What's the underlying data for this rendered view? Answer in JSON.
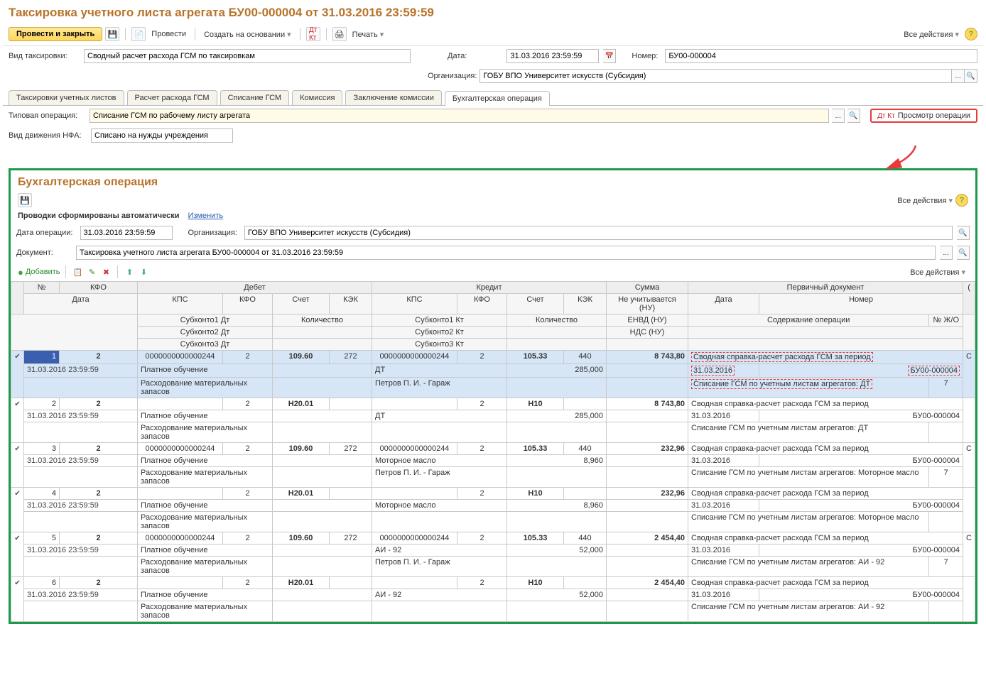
{
  "title": "Таксировка учетного листа агрегата БУ00-000004 от 31.03.2016 23:59:59",
  "toolbar": {
    "post_close": "Провести и закрыть",
    "post": "Провести",
    "create_based": "Создать на основании",
    "print": "Печать",
    "all_actions": "Все действия"
  },
  "fields": {
    "tax_type_label": "Вид таксировки:",
    "tax_type": "Сводный расчет расхода ГСМ по таксировкам",
    "date_label": "Дата:",
    "date": "31.03.2016 23:59:59",
    "number_label": "Номер:",
    "number": "БУ00-000004",
    "org_label": "Организация:",
    "org": "ГОБУ ВПО Университет искусств (Субсидия)",
    "typ_op_label": "Типовая операция:",
    "typ_op": "Списание ГСМ по рабочему листу агрегата",
    "nfa_label": "Вид движения НФА:",
    "nfa": "Списано на нужды учреждения"
  },
  "tabs": [
    "Таксировки учетных листов",
    "Расчет расхода ГСМ",
    "Списание ГСМ",
    "Комиссия",
    "Заключение комиссии",
    "Бухгалтерская операция"
  ],
  "view_op": "Просмотр операции",
  "panel": {
    "title": "Бухгалтерская операция",
    "auto": "Проводки сформированы автоматически",
    "change": "Изменить",
    "date_label": "Дата операции:",
    "date": "31.03.2016 23:59:59",
    "org_label": "Организация:",
    "org": "ГОБУ ВПО Университет искусств (Субсидия)",
    "doc_label": "Документ:",
    "doc": "Таксировка учетного листа агрегата БУ00-000004 от 31.03.2016 23:59:59",
    "add": "Добавить",
    "all_actions": "Все действия"
  },
  "headers": {
    "n": "№",
    "kfo": "КФО",
    "debet": "Дебет",
    "kredit": "Кредит",
    "summa": "Сумма",
    "primary": "Первичный документ",
    "date": "Дата",
    "kps": "КПС",
    "kfo2": "КФО",
    "acct": "Счет",
    "kek": "КЭК",
    "nu": "Не учитывается (НУ)",
    "pdate": "Дата",
    "pnum": "Номер",
    "sub1d": "Субконто1 Дт",
    "qty": "Количество",
    "sub1k": "Субконто1 Кт",
    "envd": "ЕНВД (НУ)",
    "content": "Содержание операции",
    "zho": "№ Ж/О",
    "sub2d": "Субконто2 Дт",
    "sub2k": "Субконто2 Кт",
    "nds": "НДС (НУ)",
    "sub3d": "Субконто3 Дт",
    "sub3k": "Субконто3 Кт"
  },
  "rows": [
    {
      "n": "1",
      "kfo": "2",
      "date": "31.03.2016 23:59:59",
      "dkps": "0000000000000244",
      "dkfo": "2",
      "dacct": "109.60",
      "dkek": "272",
      "kkps": "0000000000000244",
      "kkfo": "2",
      "kacct": "105.33",
      "kkek": "440",
      "sum": "8 743,80",
      "pdoc": "Сводная справка-расчет расхода ГСМ за период",
      "s1d": "Платное обучение",
      "s1k": "ДТ",
      "kqty": "285,000",
      "pdate": "31.03.2016",
      "pnum": "БУ00-000004",
      "s2d": "Расходование материальных запасов",
      "s2k": "Петров П. И. - Гараж",
      "content": "Списание ГСМ по учетным листам агрегатов: ДТ",
      "zho": "7",
      "sel": true,
      "dash": true,
      "ext": "С"
    },
    {
      "n": "2",
      "kfo": "2",
      "date": "31.03.2016 23:59:59",
      "dkps": "",
      "dkfo": "2",
      "dacct": "Н20.01",
      "dkek": "",
      "kkps": "",
      "kkfo": "2",
      "kacct": "Н10",
      "kkek": "",
      "sum": "8 743,80",
      "pdoc": "Сводная справка-расчет расхода ГСМ за период",
      "s1d": "Платное обучение",
      "s1k": "ДТ",
      "kqty": "285,000",
      "pdate": "31.03.2016",
      "pnum": "БУ00-000004",
      "s2d": "Расходование материальных запасов",
      "s2k": "",
      "content": "Списание ГСМ по учетным листам агрегатов: ДТ",
      "zho": ""
    },
    {
      "n": "3",
      "kfo": "2",
      "date": "31.03.2016 23:59:59",
      "dkps": "0000000000000244",
      "dkfo": "2",
      "dacct": "109.60",
      "dkek": "272",
      "kkps": "0000000000000244",
      "kkfo": "2",
      "kacct": "105.33",
      "kkek": "440",
      "sum": "232,96",
      "pdoc": "Сводная справка-расчет расхода ГСМ за период",
      "s1d": "Платное обучение",
      "s1k": "Моторное масло",
      "kqty": "8,960",
      "pdate": "31.03.2016",
      "pnum": "БУ00-000004",
      "s2d": "Расходование материальных запасов",
      "s2k": "Петров П. И. - Гараж",
      "content": "Списание ГСМ по учетным листам агрегатов: Моторное масло",
      "zho": "7",
      "ext": "С"
    },
    {
      "n": "4",
      "kfo": "2",
      "date": "31.03.2016 23:59:59",
      "dkps": "",
      "dkfo": "2",
      "dacct": "Н20.01",
      "dkek": "",
      "kkps": "",
      "kkfo": "2",
      "kacct": "Н10",
      "kkek": "",
      "sum": "232,96",
      "pdoc": "Сводная справка-расчет расхода ГСМ за период",
      "s1d": "Платное обучение",
      "s1k": "Моторное масло",
      "kqty": "8,960",
      "pdate": "31.03.2016",
      "pnum": "БУ00-000004",
      "s2d": "Расходование материальных запасов",
      "s2k": "",
      "content": "Списание ГСМ по учетным листам агрегатов: Моторное масло",
      "zho": ""
    },
    {
      "n": "5",
      "kfo": "2",
      "date": "31.03.2016 23:59:59",
      "dkps": "0000000000000244",
      "dkfo": "2",
      "dacct": "109.60",
      "dkek": "272",
      "kkps": "0000000000000244",
      "kkfo": "2",
      "kacct": "105.33",
      "kkek": "440",
      "sum": "2 454,40",
      "pdoc": "Сводная справка-расчет расхода ГСМ за период",
      "s1d": "Платное обучение",
      "s1k": "АИ - 92",
      "kqty": "52,000",
      "pdate": "31.03.2016",
      "pnum": "БУ00-000004",
      "s2d": "Расходование материальных запасов",
      "s2k": "Петров П. И. - Гараж",
      "content": "Списание ГСМ по учетным листам агрегатов: АИ - 92",
      "zho": "7",
      "ext": "С"
    },
    {
      "n": "6",
      "kfo": "2",
      "date": "31.03.2016 23:59:59",
      "dkps": "",
      "dkfo": "2",
      "dacct": "Н20.01",
      "dkek": "",
      "kkps": "",
      "kkfo": "2",
      "kacct": "Н10",
      "kkek": "",
      "sum": "2 454,40",
      "pdoc": "Сводная справка-расчет расхода ГСМ за период",
      "s1d": "Платное обучение",
      "s1k": "АИ - 92",
      "kqty": "52,000",
      "pdate": "31.03.2016",
      "pnum": "БУ00-000004",
      "s2d": "Расходование материальных запасов",
      "s2k": "",
      "content": "Списание ГСМ по учетным листам агрегатов: АИ - 92",
      "zho": ""
    }
  ]
}
